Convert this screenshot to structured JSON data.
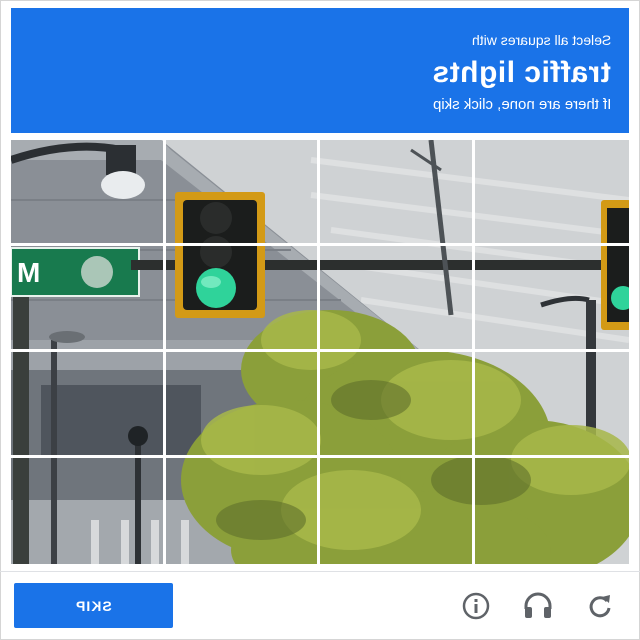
{
  "header": {
    "instruction": "Select all squares with",
    "target": "traffic lights",
    "hint": "If there are none, click skip"
  },
  "grid": {
    "rows": 4,
    "cols": 4,
    "cells": [
      "tile-1",
      "tile-2",
      "tile-3",
      "tile-4",
      "tile-5",
      "tile-6",
      "tile-7",
      "tile-8",
      "tile-9",
      "tile-10",
      "tile-11",
      "tile-12",
      "tile-13",
      "tile-14",
      "tile-15",
      "tile-16"
    ]
  },
  "scene": {
    "sign_text": "M"
  },
  "footer": {
    "skip_label": "SKIP",
    "icons": [
      "reload-icon",
      "audio-icon",
      "info-icon"
    ]
  },
  "colors": {
    "accent": "#1a73e8",
    "signal_green": "#2fd39a",
    "signal_frame": "#d39a16"
  }
}
